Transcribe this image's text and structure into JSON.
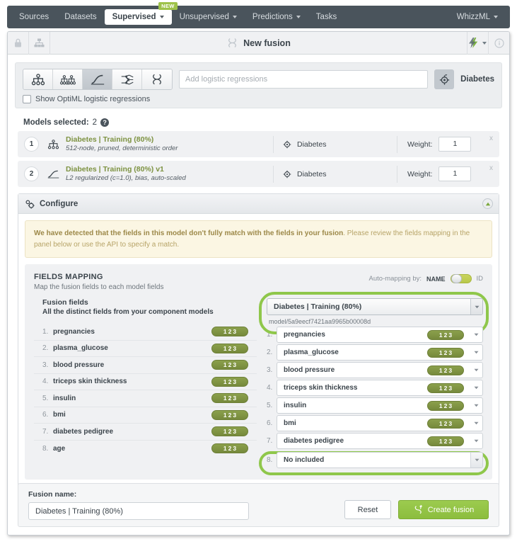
{
  "topnav": {
    "items": [
      {
        "label": "Sources",
        "caret": false,
        "active": false,
        "badge": null
      },
      {
        "label": "Datasets",
        "caret": false,
        "active": false,
        "badge": null
      },
      {
        "label": "Supervised",
        "caret": true,
        "active": true,
        "badge": "NEW"
      },
      {
        "label": "Unsupervised",
        "caret": true,
        "active": false,
        "badge": null
      },
      {
        "label": "Predictions",
        "caret": true,
        "active": false,
        "badge": null
      },
      {
        "label": "Tasks",
        "caret": false,
        "active": false,
        "badge": null
      }
    ],
    "account": "WhizzML",
    "brand_green": "#9ec24a",
    "bar_color": "#4a545c"
  },
  "resource_header": {
    "title": "New fusion",
    "left_icons": [
      "lock-icon",
      "tree-icon"
    ],
    "right_icons": [
      "actions-bolt-icon",
      "info-icon"
    ]
  },
  "typebar": {
    "type_buttons": [
      {
        "name": "decision-tree-icon",
        "selected": false
      },
      {
        "name": "ensemble-icon",
        "selected": false
      },
      {
        "name": "logistic-regression-icon",
        "selected": true
      },
      {
        "name": "deepnet-icon",
        "selected": false
      },
      {
        "name": "fusion-icon",
        "selected": false
      }
    ],
    "search_placeholder": "Add logistic regressions",
    "objective_icon": "objective-target-icon",
    "objective_name": "Diabetes",
    "checkbox_label": "Show OptiML logistic regressions",
    "checkbox_checked": false
  },
  "models_selected": {
    "label": "Models selected:",
    "count": "2",
    "weight_label": "Weight:",
    "close_glyph": "x",
    "rows": [
      {
        "num": "1",
        "icon": "decision-tree-icon",
        "title": "Diabetes | Training (80%)",
        "subtitle": "512-node, pruned, deterministic order",
        "objective": "Diabetes",
        "weight": "1"
      },
      {
        "num": "2",
        "icon": "logistic-regression-icon",
        "title": "Diabetes | Training (80%) v1",
        "subtitle": "L2 regularized (c=1.0), bias, auto-scaled",
        "objective": "Diabetes",
        "weight": "1"
      }
    ]
  },
  "configure": {
    "title": "Configure",
    "icon": "gear-icon",
    "collapse_icon": "collapse-up-icon",
    "warning_bold": "We have detected that the fields in this model don't fully match with the fields in your fusion",
    "warning_rest": ". Please review the fields mapping in the panel below or use the API to specify a match."
  },
  "fields_mapping": {
    "heading": "FIELDS MAPPING",
    "subheading": "Map the fusion fields to each model fields",
    "automapping_label": "Auto-mapping by:",
    "automapping_option_on": "NAME",
    "automapping_option_off": "ID",
    "automapping_value": "NAME",
    "fusion_fields_heading": "Fusion fields",
    "fusion_fields_subheading": "All the distinct fields from your component models",
    "badge_text": "123",
    "badge_color": "#7d9241",
    "highlight_color": "#8fc74b",
    "model_select_value": "Diabetes | Training (80%)",
    "model_id": "model/5a9eecf7421aa9965b00008d",
    "fusion_fields": [
      {
        "num": "1.",
        "name": "pregnancies",
        "type": "123"
      },
      {
        "num": "2.",
        "name": "plasma_glucose",
        "type": "123"
      },
      {
        "num": "3.",
        "name": "blood pressure",
        "type": "123"
      },
      {
        "num": "4.",
        "name": "triceps skin thickness",
        "type": "123"
      },
      {
        "num": "5.",
        "name": "insulin",
        "type": "123"
      },
      {
        "num": "6.",
        "name": "bmi",
        "type": "123"
      },
      {
        "num": "7.",
        "name": "diabetes pedigree",
        "type": "123"
      },
      {
        "num": "8.",
        "name": "age",
        "type": "123"
      }
    ],
    "model_fields": [
      {
        "num": "1.",
        "name": "pregnancies",
        "type": "123",
        "has_type": true
      },
      {
        "num": "2.",
        "name": "plasma_glucose",
        "type": "123",
        "has_type": true
      },
      {
        "num": "3.",
        "name": "blood pressure",
        "type": "123",
        "has_type": true
      },
      {
        "num": "4.",
        "name": "triceps skin thickness",
        "type": "123",
        "has_type": true
      },
      {
        "num": "5.",
        "name": "insulin",
        "type": "123",
        "has_type": true
      },
      {
        "num": "6.",
        "name": "bmi",
        "type": "123",
        "has_type": true
      },
      {
        "num": "7.",
        "name": "diabetes pedigree",
        "type": "123",
        "has_type": true
      },
      {
        "num": "8.",
        "name": "No included",
        "type": "",
        "has_type": false
      }
    ]
  },
  "footer": {
    "name_label": "Fusion name:",
    "name_value": "Diabetes | Training (80%)",
    "reset_label": "Reset",
    "create_label": "Create fusion",
    "create_icon": "fusion-plus-icon"
  }
}
